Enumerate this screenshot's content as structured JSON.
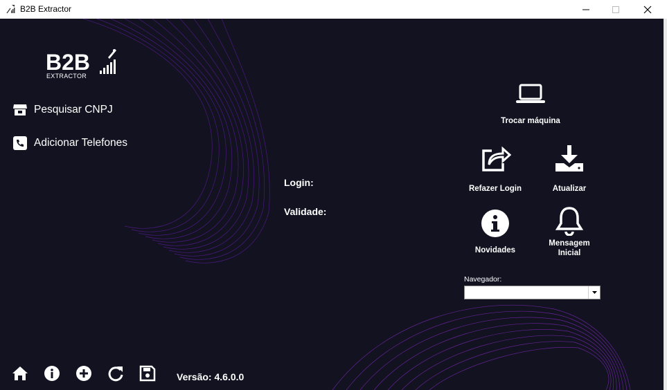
{
  "window": {
    "title": "B2B Extractor"
  },
  "logo": {
    "text": "B2B",
    "subtitle": "EXTRACTOR"
  },
  "sidebar": {
    "items": [
      {
        "label": "Pesquisar CNPJ",
        "icon": "store-icon"
      },
      {
        "label": "Adicionar Telefones",
        "icon": "phone-icon"
      }
    ]
  },
  "info": {
    "login_label": "Login:",
    "validade_label": "Validade:"
  },
  "actions": {
    "trocar_maquina": "Trocar máquina",
    "refazer_login": "Refazer Login",
    "atualizar": "Atualizar",
    "novidades": "Novidades",
    "mensagem_inicial": "Mensagem Inicial"
  },
  "navegador": {
    "label": "Navegador:",
    "selected": ""
  },
  "footer": {
    "buttons": [
      "home-icon",
      "info-icon",
      "plus-circle-icon",
      "refresh-icon",
      "save-icon"
    ],
    "version": "Versão: 4.6.0.0"
  },
  "colors": {
    "background": "#121221",
    "accent": "#8a2be2",
    "text": "#ffffff"
  }
}
